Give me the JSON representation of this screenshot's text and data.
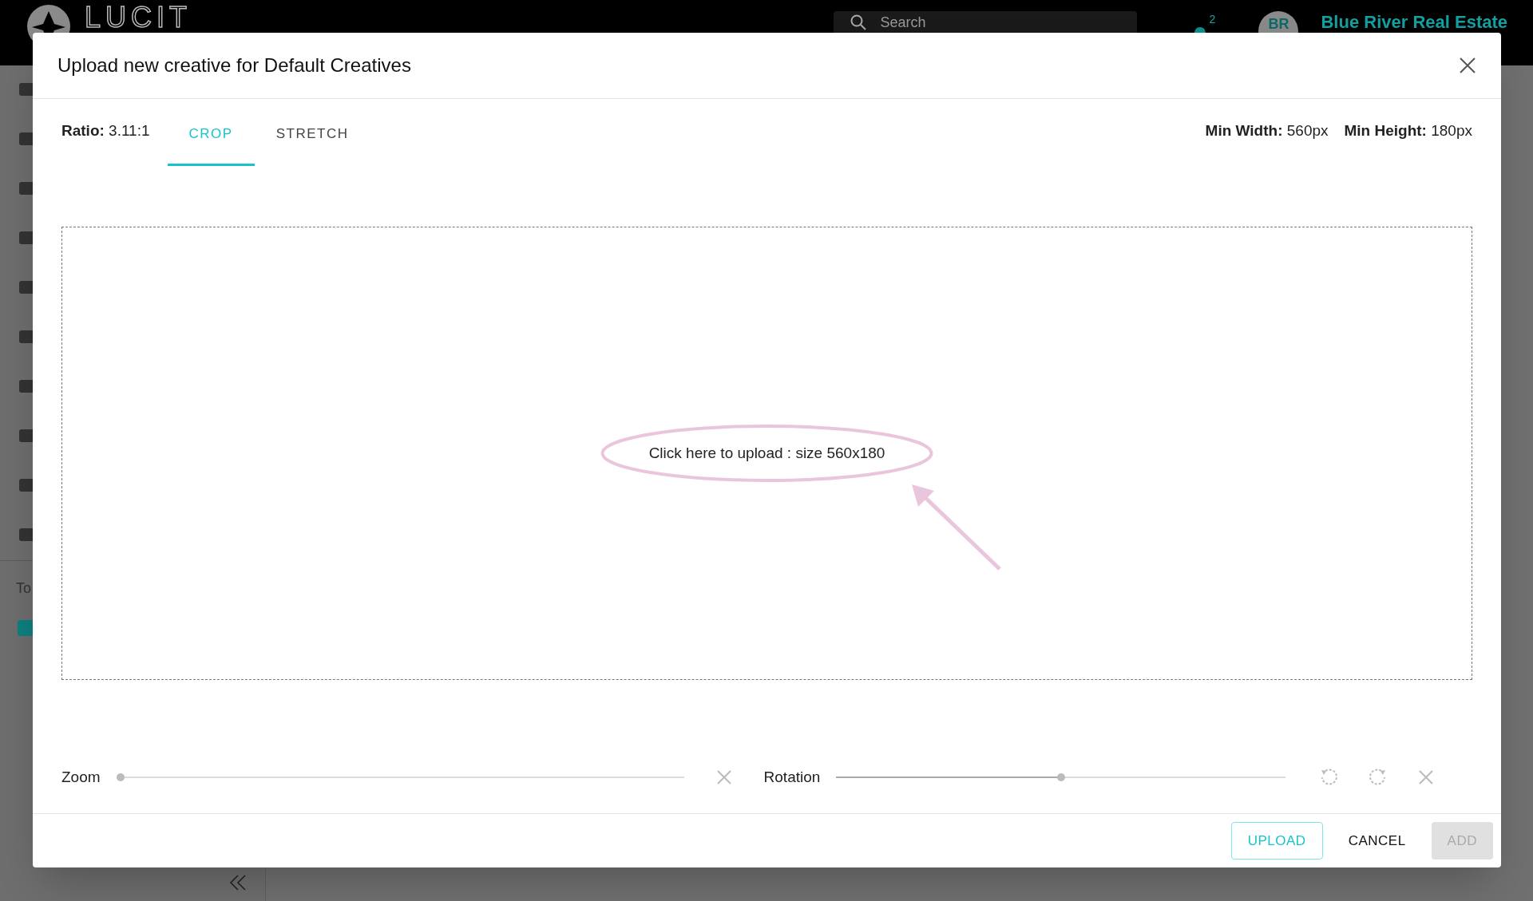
{
  "background": {
    "logo": "LUCIT",
    "search": {
      "placeholder": "Search"
    },
    "notification_count": "2",
    "account": {
      "initials": "BR",
      "name": "Blue River Real Estate"
    },
    "sidebar_text": "To"
  },
  "dialog": {
    "title": "Upload new creative for Default Creatives",
    "ratio": "**Ratio:** 3.11:1",
    "tabs": [
      {
        "label": "CROP",
        "selected": true
      },
      {
        "label": "STRETCH",
        "selected": false
      }
    ],
    "limits": [
      "**Min Width:** 560px",
      "**Min Height:** 180px"
    ],
    "upload_prompt": "Click here to upload : size 560x180",
    "sliders": [
      {
        "label": "Zoom",
        "level": 0
      },
      {
        "label": "Rotation",
        "level": 0.5
      }
    ],
    "buttons": [
      {
        "label": "UPLOAD",
        "kind": "outlined"
      },
      {
        "label": "CANCEL",
        "kind": "text"
      },
      {
        "label": "ADD",
        "kind": "disabled"
      }
    ]
  }
}
